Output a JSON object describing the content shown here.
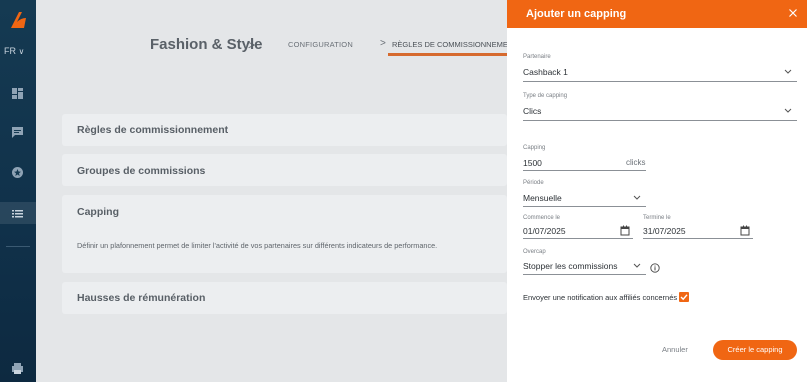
{
  "sidebar": {
    "lang_label": "FR",
    "icons": [
      "logo-icon",
      "dashboard-icon",
      "chat-icon",
      "star-icon",
      "list-icon",
      "printer-icon"
    ]
  },
  "breadcrumb": {
    "title": "Fashion & Style",
    "sep": ">",
    "configuration": "CONFIGURATION",
    "regles": "RÈGLES DE COMMISSIONNEMENT"
  },
  "cards": {
    "regles": "Règles de commissionnement",
    "groupes": "Groupes de commissions",
    "capping": "Capping",
    "capping_desc": "Définir un plafonnement permet de limiter l'activité de vos partenaires sur différents indicateurs de performance.",
    "hausses": "Hausses de rémunération"
  },
  "panel": {
    "title": "Ajouter un capping",
    "partenaire_label": "Partenaire",
    "partenaire_value": "Cashback 1",
    "type_label": "Type de capping",
    "type_value": "Clics",
    "capping_label": "Capping",
    "capping_value": "1500",
    "capping_suffix": "clicks",
    "periode_label": "Période",
    "periode_value": "Mensuelle",
    "commence_label": "Commence le",
    "commence_value": "01/07/2025",
    "termine_label": "Termine le",
    "termine_value": "31/07/2025",
    "overcap_label": "Overcap",
    "overcap_value": "Stopper les commissions",
    "notification_label": "Envoyer une notification aux affiliés concernés",
    "cancel_label": "Annuler",
    "create_label": "Créer le capping"
  },
  "colors": {
    "accent": "#f06613",
    "sidebar": "#153a52"
  }
}
